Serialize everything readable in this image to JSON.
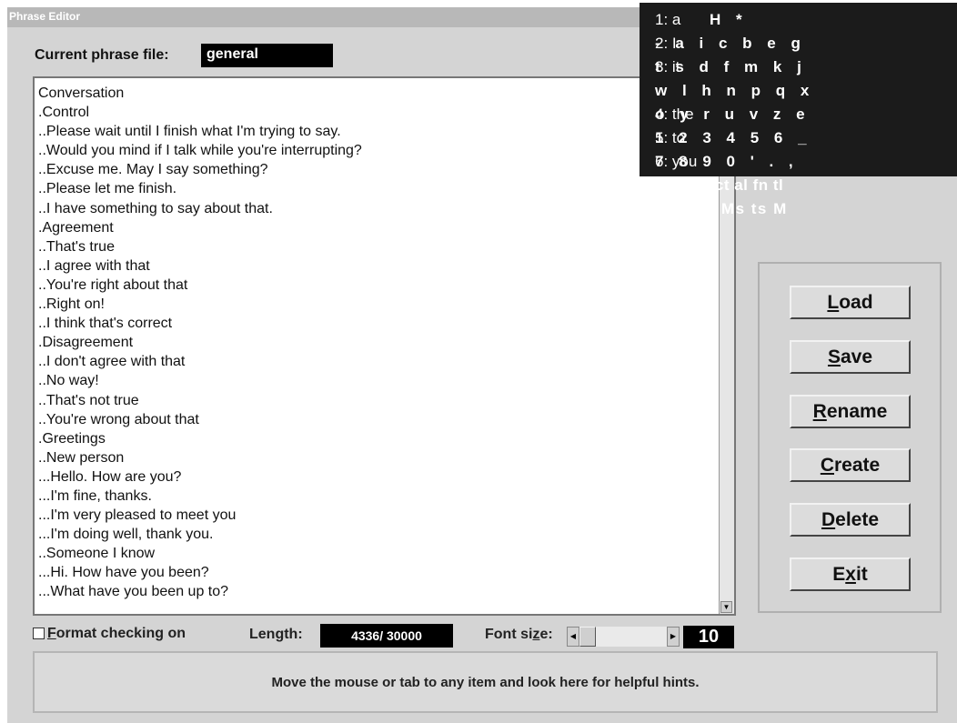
{
  "window": {
    "title": "Phrase Editor"
  },
  "phrase_file": {
    "label": "Current phrase file:",
    "value": "general"
  },
  "editor": {
    "lines": [
      "Conversation",
      ".Control",
      "..Please wait until I finish what I'm trying to say.",
      "..Would you mind if I talk while you're interrupting?",
      "..Excuse me. May I say something?",
      "..Please let me finish.",
      "..I have something to say about that.",
      ".Agreement",
      "..That's true",
      "..I agree with that",
      "..You're right about that",
      "..Right on!",
      "..I think that's correct",
      ".Disagreement",
      "..I don't agree with that",
      "..No way!",
      "..That's not true",
      "..You're wrong about that",
      ".Greetings",
      "..New person",
      "...Hello. How are you?",
      "...I'm fine, thanks.",
      "...I'm very pleased to meet you",
      "...I'm doing well, thank you.",
      "..Someone I know",
      "...Hi. How have you been?",
      "...What have you been up to?"
    ]
  },
  "prediction": {
    "items": [
      "1: a",
      "2: I",
      "3: it",
      "4: the",
      "5: to",
      "6: you"
    ]
  },
  "keyboard": {
    "rows": [
      "H *",
      "- a i c b e g",
      "t s d f m k j",
      "w l h n p q x",
      "o y r u v z e",
      "1 2 3 4 5 6 _",
      "7 8 9 0 ' . ,",
      "< <wsh ct al fn tl",
      "> # T C Ms ts M"
    ]
  },
  "buttons": {
    "load": {
      "hotkey": "L",
      "rest": "oad"
    },
    "save": {
      "hotkey": "S",
      "rest": "ave"
    },
    "rename": {
      "hotkey": "R",
      "rest": "ename"
    },
    "create": {
      "hotkey": "C",
      "rest": "reate"
    },
    "delete": {
      "hotkey": "D",
      "rest": "elete"
    },
    "exit": {
      "pre": "E",
      "hotkey": "x",
      "rest": "it"
    }
  },
  "format_checking": {
    "hotkey": "F",
    "rest": "ormat checking on",
    "checked": false
  },
  "length": {
    "label": "Length:",
    "value": "4336/ 30000"
  },
  "font_size": {
    "pre": "Font si",
    "hotkey": "z",
    "post": "e:",
    "value": "10"
  },
  "hint": {
    "text": "Move the mouse or tab to any item and look here for helpful hints."
  }
}
